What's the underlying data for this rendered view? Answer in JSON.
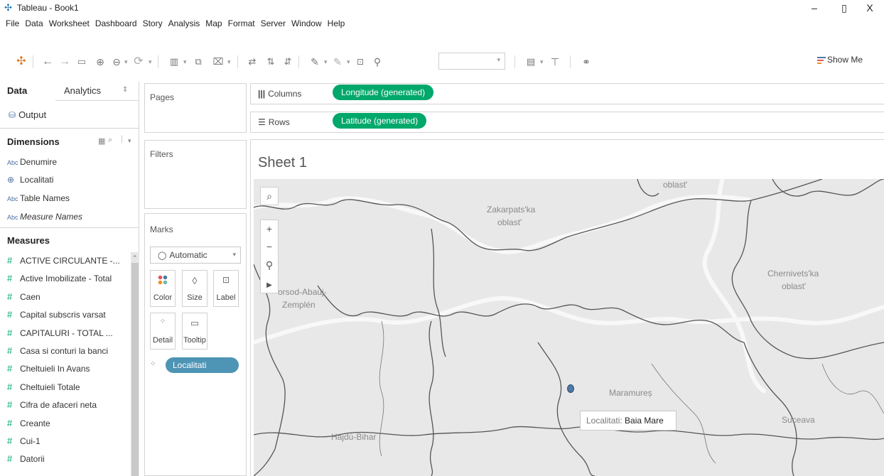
{
  "window": {
    "title": "Tableau - Book1",
    "minimize": "–",
    "restore": "▯",
    "close": "X"
  },
  "menu": [
    "File",
    "Data",
    "Worksheet",
    "Dashboard",
    "Story",
    "Analysis",
    "Map",
    "Format",
    "Server",
    "Window",
    "Help"
  ],
  "toolbar": {
    "show_me": "Show Me"
  },
  "left": {
    "tab_data": "Data",
    "tab_analytics": "Analytics",
    "datasource": "Output",
    "dimensions_title": "Dimensions",
    "dimensions": [
      {
        "icon": "Abc",
        "label": "Denumire"
      },
      {
        "icon": "globe",
        "label": "Localitati"
      },
      {
        "icon": "Abc",
        "label": "Table Names"
      },
      {
        "icon": "Abc",
        "label": "Measure Names"
      }
    ],
    "measures_title": "Measures",
    "measures": [
      "ACTIVE CIRCULANTE -...",
      "Active Imobilizate - Total",
      "Caen",
      "Capital subscris varsat",
      "CAPITALURI - TOTAL ...",
      "Casa si conturi la banci",
      "Cheltuieli In Avans",
      "Cheltuieli Totale",
      "Cifra de afaceri neta",
      "Creante",
      "Cui-1",
      "Datorii"
    ]
  },
  "cards": {
    "pages": "Pages",
    "filters": "Filters",
    "marks": "Marks",
    "mark_type": "Automatic",
    "buttons": [
      "Color",
      "Size",
      "Label",
      "Detail",
      "Tooltip"
    ],
    "detail_pill": "Localitati"
  },
  "shelves": {
    "columns_label": "Columns",
    "columns_pill": "Longitude (generated)",
    "rows_label": "Rows",
    "rows_pill": "Latitude (generated)"
  },
  "sheet": {
    "title": "Sheet 1",
    "map_labels": [
      "oblast'",
      "Zakarpats'ka",
      "oblast'",
      "Chernivets'ka",
      "oblast'",
      "orsod-Abauj-",
      "Zemplén",
      "Maramureș",
      "Suceava",
      "Hajdú-Bihar"
    ],
    "tooltip_key": "Localitati:",
    "tooltip_value": "Baia Mare"
  }
}
